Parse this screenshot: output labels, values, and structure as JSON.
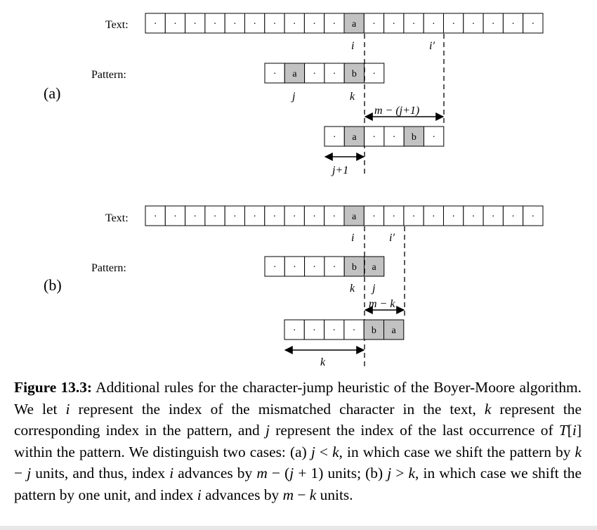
{
  "labels": {
    "text": "Text:",
    "pattern": "Pattern:",
    "case_a": "(a)",
    "case_b": "(b)"
  },
  "glyphs": {
    "empty": "·"
  },
  "case_a": {
    "text_row": {
      "length": 20,
      "highlight": [
        10
      ],
      "chars": {
        "10": "a"
      }
    },
    "pattern_row": {
      "length": 6,
      "highlight": [
        1,
        4
      ],
      "chars": {
        "1": "a",
        "4": "b"
      }
    },
    "shifted_row": {
      "length": 6,
      "highlight": [
        1,
        4
      ],
      "chars": {
        "1": "a",
        "4": "b"
      }
    },
    "marks": {
      "i": "i",
      "i_prime": "i′",
      "j": "j",
      "k": "k"
    },
    "dim_right": "m − (j+1)",
    "dim_left": "j+1"
  },
  "case_b": {
    "text_row": {
      "length": 20,
      "highlight": [
        10
      ],
      "chars": {
        "10": "a"
      }
    },
    "pattern_row": {
      "length": 6,
      "highlight": [
        4,
        5
      ],
      "chars": {
        "4": "b",
        "5": "a"
      }
    },
    "shifted_row": {
      "length": 6,
      "highlight": [
        4,
        5
      ],
      "chars": {
        "4": "b",
        "5": "a"
      }
    },
    "marks": {
      "i": "i",
      "i_prime": "i′",
      "j": "j",
      "k": "k"
    },
    "dim_right": "m − k",
    "dim_left": "k"
  },
  "caption": {
    "label": "Figure 13.3:",
    "parts": [
      {
        "t": " Additional rules for the character-jump heuristic of the Boyer-Moore algorithm. We let "
      },
      {
        "i": "i"
      },
      {
        "t": " represent the index of the mismatched character in the text, "
      },
      {
        "i": "k"
      },
      {
        "t": " represent the corresponding index in the pattern, and "
      },
      {
        "i": "j"
      },
      {
        "t": " represent the index of the last occurrence of "
      },
      {
        "i": "T"
      },
      {
        "t": "["
      },
      {
        "i": "i"
      },
      {
        "t": "] within the pattern. We distinguish two cases: (a) "
      },
      {
        "i": "j"
      },
      {
        "t": " < "
      },
      {
        "i": "k"
      },
      {
        "t": ", in which case we shift the pattern by "
      },
      {
        "i": "k"
      },
      {
        "t": " − "
      },
      {
        "i": "j"
      },
      {
        "t": " units, and thus, index "
      },
      {
        "i": "i"
      },
      {
        "t": " advances by "
      },
      {
        "i": "m"
      },
      {
        "t": " − ("
      },
      {
        "i": "j"
      },
      {
        "t": " + 1) units; (b) "
      },
      {
        "i": "j"
      },
      {
        "t": " > "
      },
      {
        "i": "k"
      },
      {
        "t": ", in which case we shift the pattern by one unit, and index "
      },
      {
        "i": "i"
      },
      {
        "t": " advances by "
      },
      {
        "i": "m"
      },
      {
        "t": " − "
      },
      {
        "i": "k"
      },
      {
        "t": " units."
      }
    ]
  }
}
